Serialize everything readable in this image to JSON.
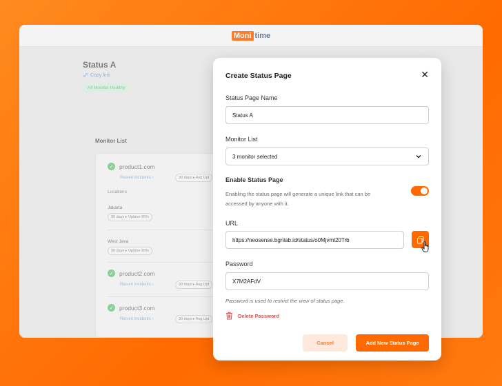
{
  "app": {
    "logo_part1": "Moni",
    "logo_part2": "time",
    "status_title": "Status A",
    "copy_link": "Copy link",
    "healthy_badge": "All Monitor Healthy",
    "monitor_list_title": "Monitor List",
    "monitors": [
      {
        "name": "product1.com",
        "recent": "Recent Incidents ›",
        "range": "30 days ▸ Avg Upt"
      },
      {
        "name": "product2.com",
        "recent": "Recent Incidents ›",
        "range": "30 days ▸ Avg Upt"
      },
      {
        "name": "product3.com",
        "recent": "Recent Incidents ›",
        "range": "30 days ▸ Avg Upt"
      }
    ],
    "locations_label": "Locations",
    "locations": [
      {
        "name": "Jakarta",
        "uptime": "30 days ▸ Uptime 95%"
      },
      {
        "name": "West Java",
        "uptime": "30 days ▸ Uptime 95%"
      }
    ]
  },
  "modal": {
    "title": "Create Status Page",
    "close_symbol": "✕",
    "name_label": "Status Page Name",
    "name_value": "Status A",
    "monitor_label": "Monitor List",
    "monitor_value": "3 monitor selected",
    "enable_label": "Enable Status Page",
    "enable_desc": "Enabling the status page will generate a unique link that can be accessed by anyone with it.",
    "enabled": true,
    "url_label": "URL",
    "url_value": "https://neosense.bgnlab.id/status/o0Mjvml20Trb",
    "password_label": "Password",
    "password_value": "X7M2AFdV",
    "password_helper": "Password is used to restrict the view of status page.",
    "delete_label": "Delete Password",
    "cancel_label": "Cancel",
    "add_label": "Add New Status Page"
  },
  "colors": {
    "accent": "#ff6a00",
    "danger": "#e05050",
    "success": "#8ccf9a"
  },
  "icons": [
    "link-icon",
    "check-circle-icon",
    "close-icon",
    "chevron-down-icon",
    "copy-icon",
    "trash-icon",
    "hand-cursor-icon"
  ]
}
